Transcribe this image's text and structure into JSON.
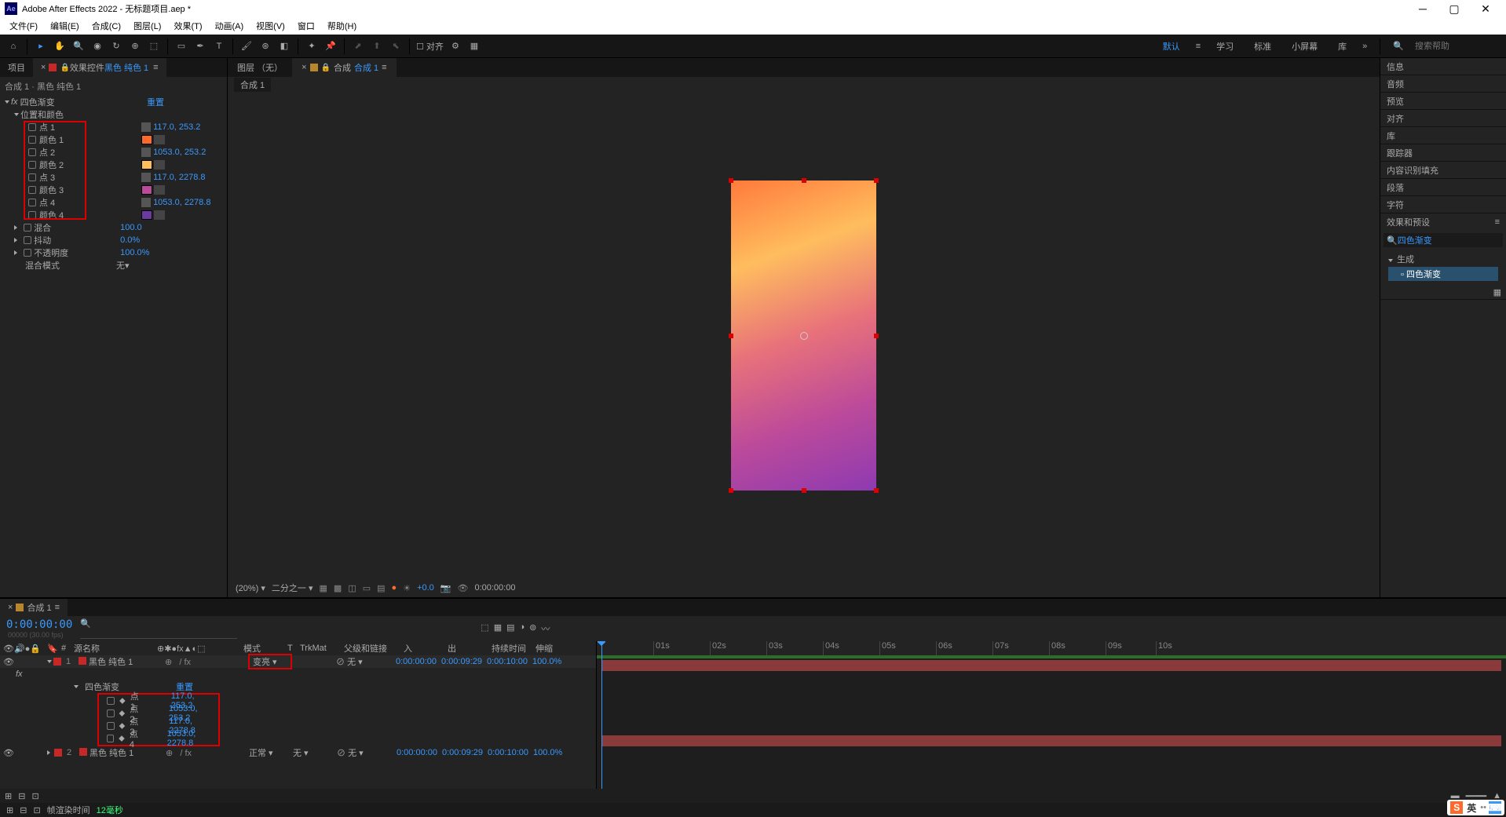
{
  "app": {
    "title": "Adobe After Effects 2022 - 无标题项目.aep *",
    "logo": "Ae"
  },
  "menus": [
    "文件(F)",
    "编辑(E)",
    "合成(C)",
    "图层(L)",
    "效果(T)",
    "动画(A)",
    "视图(V)",
    "窗口",
    "帮助(H)"
  ],
  "toolbar": {
    "snap_label": "对齐",
    "ws": [
      "默认",
      "学习",
      "标准",
      "小屏幕",
      "库"
    ],
    "ws_active": 0,
    "search_placeholder": "搜索帮助"
  },
  "left_panel": {
    "tabs": {
      "project": "项目",
      "effect_controls": "效果控件",
      "ec_suffix": "黑色 纯色 1"
    },
    "path": "合成 1 · 黑色 纯色 1",
    "effect": {
      "name": "四色渐变",
      "reset": "重置",
      "group": "位置和颜色",
      "rows": [
        {
          "label": "点 1",
          "value": "117.0, 253.2",
          "type": "point"
        },
        {
          "label": "颜色 1",
          "color": "#ff6a2c",
          "type": "color"
        },
        {
          "label": "点 2",
          "value": "1053.0, 253.2",
          "type": "point"
        },
        {
          "label": "颜色 2",
          "color": "#ffbd5e",
          "type": "color"
        },
        {
          "label": "点 3",
          "value": "117.0, 2278.8",
          "type": "point"
        },
        {
          "label": "颜色 3",
          "color": "#bc4a9a",
          "type": "color"
        },
        {
          "label": "点 4",
          "value": "1053.0, 2278.8",
          "type": "point"
        },
        {
          "label": "颜色 4",
          "color": "#6a3aa0",
          "type": "color"
        }
      ],
      "blend": {
        "label": "混合",
        "value": "100.0"
      },
      "jitter": {
        "label": "抖动",
        "value": "0.0%"
      },
      "opacity": {
        "label": "不透明度",
        "value": "100.0%"
      },
      "blendmode": {
        "label": "混合模式",
        "value": "无"
      }
    }
  },
  "center": {
    "tab_layer": "图层 （无）",
    "tab_comp_prefix": "合成",
    "tab_comp_name": "合成 1",
    "sub_tab": "合成 1",
    "footer": {
      "zoom": "(20%)",
      "quality": "二分之一",
      "exposure": "+0.0",
      "time": "0:00:00:00"
    }
  },
  "right": {
    "panels": [
      "信息",
      "音频",
      "预览",
      "对齐",
      "库",
      "跟踪器",
      "内容识别填充",
      "段落",
      "字符"
    ],
    "effects_presets": {
      "title": "效果和预设",
      "search_value": "四色渐变",
      "category": "生成",
      "hit": "四色渐变"
    }
  },
  "timeline": {
    "tab": "合成 1",
    "timecode": "0:00:00:00",
    "timecode_sub": "00000 (30.00 fps)",
    "columns": {
      "source": "源名称",
      "mode": "模式",
      "trkmat": "TrkMat",
      "parent": "父级和链接",
      "in": "入",
      "out": "出",
      "dur": "持续时间",
      "stretch": "伸缩"
    },
    "ruler": [
      "01s",
      "02s",
      "03s",
      "04s",
      "05s",
      "06s",
      "07s",
      "08s",
      "09s",
      "10s"
    ],
    "layers": [
      {
        "num": "1",
        "color": "#c62828",
        "name": "黑色 纯色 1",
        "mode": "变亮",
        "trkmat": "",
        "parent": "无",
        "in": "0:00:00:00",
        "out": "0:00:09:29",
        "dur": "0:00:10:00",
        "stretch": "100.0%"
      },
      {
        "num": "2",
        "color": "#c62828",
        "name": "黑色 纯色 1",
        "mode": "正常",
        "trkmat": "无",
        "parent": "无",
        "in": "0:00:00:00",
        "out": "0:00:09:29",
        "dur": "0:00:10:00",
        "stretch": "100.0%"
      }
    ],
    "layer1_effect": {
      "name": "四色渐变",
      "reset": "重置",
      "points": [
        {
          "label": "点 1",
          "value": "117.0, 253.2"
        },
        {
          "label": "点 2",
          "value": "1053.0, 253.2"
        },
        {
          "label": "点 3",
          "value": "117.0, 2278.8"
        },
        {
          "label": "点 4",
          "value": "1053.0, 2278.8"
        }
      ]
    }
  },
  "status": {
    "render_label": "帧渲染时间",
    "render_time": "12毫秒"
  },
  "ime": {
    "s": "S",
    "lang": "英"
  }
}
